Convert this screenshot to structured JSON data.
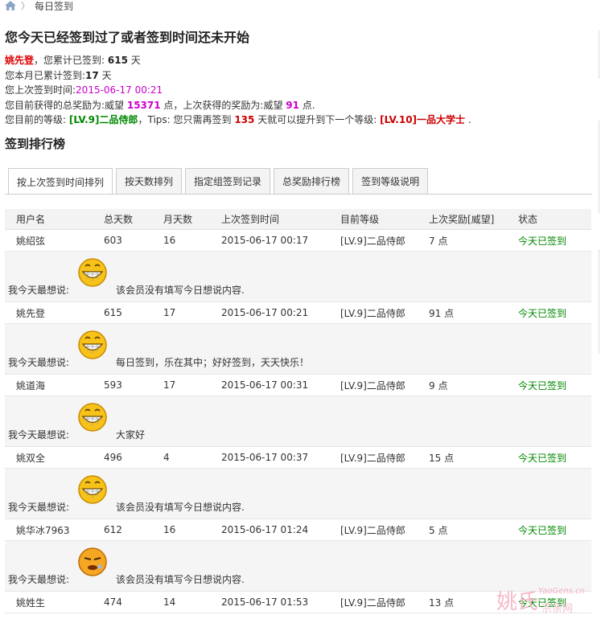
{
  "breadcrumb": {
    "current": "每日签到"
  },
  "title": "您今天已经签到过了或者签到时间还未开始",
  "info": {
    "user": "姚先登",
    "line1_mid": "，您累计已签到: ",
    "total_days": "615",
    "line1_end": " 天",
    "line2_pre": "您本月已累计签到:",
    "month_days": "17",
    "line2_end": " 天",
    "line3_pre": "您上次签到时间:",
    "last_time": "2015-06-17 00:21",
    "line4_pre": "您目前获得的总奖励为:威望 ",
    "total_reward": "15371",
    "line4_mid": " 点，上次获得的奖励为:威望 ",
    "last_reward": "91",
    "line4_end": " 点.",
    "line5_pre": "您目前的等级: ",
    "level": "[LV.9]二品侍郎",
    "line5_mid": "，Tips: 您只需再签到 ",
    "days_needed": "135",
    "line5_mid2": " 天就可以提升到下一个等级: ",
    "next_level": "[LV.10]一品大学士",
    "line5_end": " ."
  },
  "rank_title": "签到排行榜",
  "tabs": [
    "按上次签到时间排列",
    "按天数排列",
    "指定组签到记录",
    "总奖励排行榜",
    "签到等级说明"
  ],
  "headers": [
    "用户名",
    "总天数",
    "月天数",
    "上次签到时间",
    "目前等级",
    "上次奖励[威望]",
    "状态"
  ],
  "msg_label": "我今天最想说:",
  "rows": [
    {
      "name": "姚绍弦",
      "total": "603",
      "month": "16",
      "time": "2015-06-17 00:17",
      "level": "[LV.9]二品侍郎",
      "reward": "7 点",
      "status": "今天已签到",
      "msg": "该会员没有填写今日想说内容."
    },
    {
      "name": "姚先登",
      "total": "615",
      "month": "17",
      "time": "2015-06-17 00:21",
      "level": "[LV.9]二品侍郎",
      "reward": "91 点",
      "status": "今天已签到",
      "msg": "每日签到，乐在其中；好好签到，天天快乐！"
    },
    {
      "name": "姚道海",
      "total": "593",
      "month": "17",
      "time": "2015-06-17 00:31",
      "level": "[LV.9]二品侍郎",
      "reward": "9 点",
      "status": "今天已签到",
      "msg": "大家好"
    },
    {
      "name": "姚双全",
      "total": "496",
      "month": "4",
      "time": "2015-06-17 00:37",
      "level": "[LV.9]二品侍郎",
      "reward": "15 点",
      "status": "今天已签到",
      "msg": "该会员没有填写今日想说内容."
    },
    {
      "name": "姚华冰7963",
      "total": "612",
      "month": "16",
      "time": "2015-06-17 01:24",
      "level": "[LV.9]二品侍郎",
      "reward": "5 点",
      "status": "今天已签到",
      "msg": "该会员没有填写今日想说内容."
    },
    {
      "name": "姚姓生",
      "total": "474",
      "month": "14",
      "time": "2015-06-17 01:53",
      "level": "[LV.9]二品侍郎",
      "reward": "13 点",
      "status": "今天已签到"
    }
  ],
  "watermark": {
    "big": "姚氏",
    "small": "YaoGens.cn",
    "small2": "宗亲网"
  },
  "colors": {
    "status_green": "#008800",
    "highlight_pink": "#cc00cc",
    "user_red": "#dd0000"
  }
}
